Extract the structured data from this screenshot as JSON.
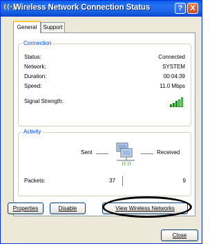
{
  "window": {
    "title": "Wireless Network Connection Status",
    "help_label": "?",
    "close_label": "X"
  },
  "tabs": [
    {
      "label": "General",
      "selected": true
    },
    {
      "label": "Support",
      "selected": false
    }
  ],
  "connection": {
    "legend": "Connection",
    "status_label": "Status:",
    "status_value": "Connected",
    "network_label": "Network:",
    "network_value": "SYSTEM",
    "duration_label": "Duration:",
    "duration_value": "00:04:39",
    "speed_label": "Speed:",
    "speed_value": "11.0 Mbps",
    "signal_label": "Signal Strength:",
    "signal_bars": 5,
    "signal_color": "#1B9E1B"
  },
  "activity": {
    "legend": "Activity",
    "sent_label": "Sent",
    "received_label": "Received",
    "packets_label": "Packets:",
    "packets_sent": "37",
    "packets_received": "9"
  },
  "buttons": {
    "properties": "Properties",
    "disable": "Disable",
    "view_wireless": "View Wireless Networks",
    "close": "Close"
  },
  "colors": {
    "titlebar": "#0A5FEA",
    "group_legend": "#0046D5",
    "dialog_bg": "#ECE9D8"
  }
}
